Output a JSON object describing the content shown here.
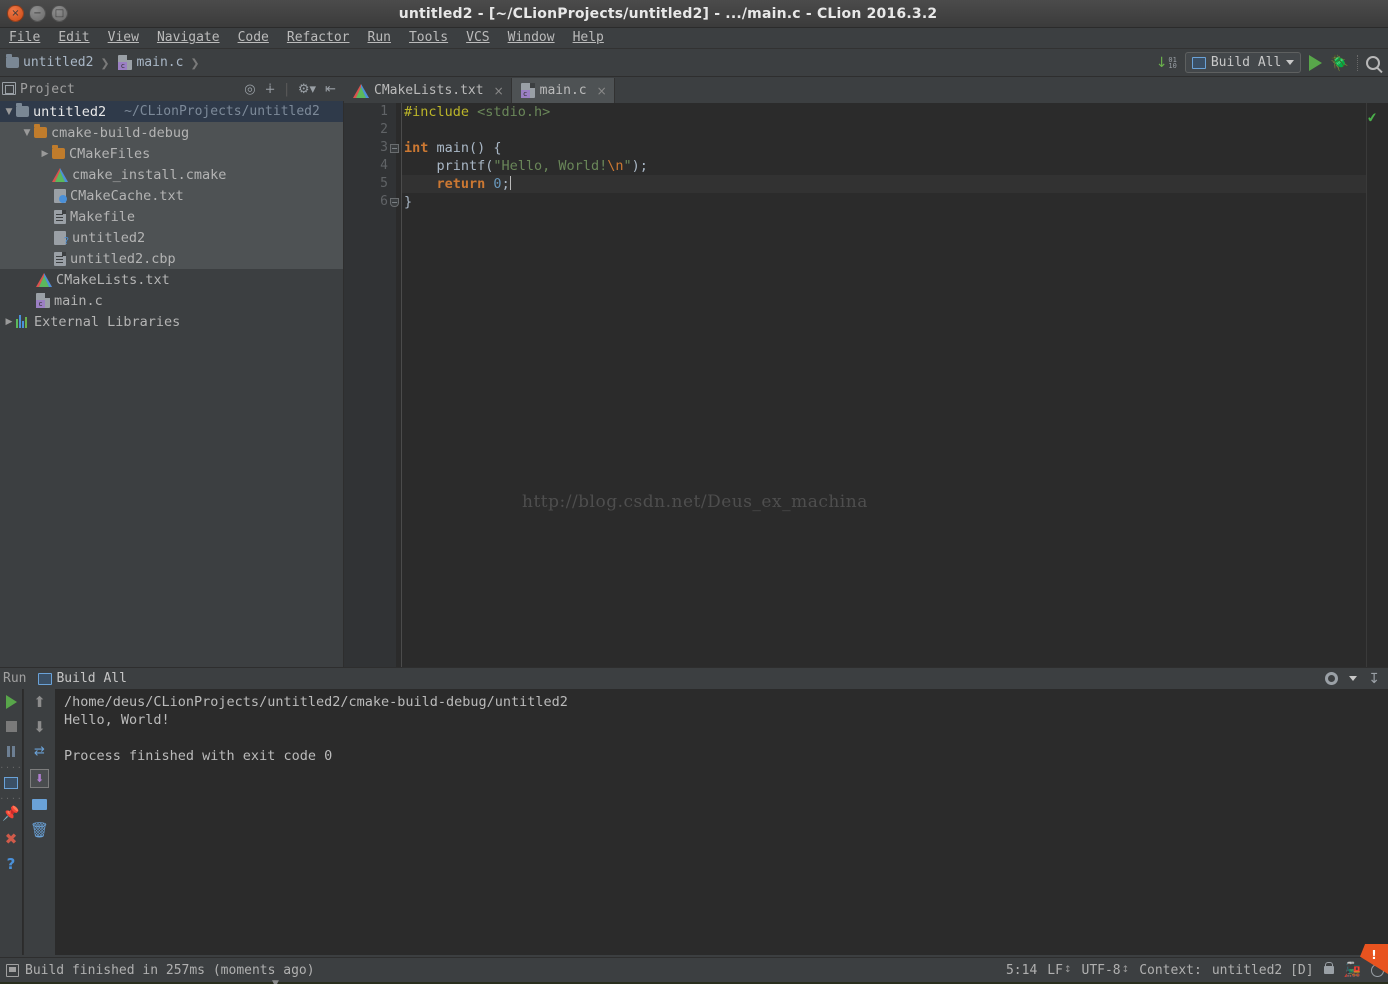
{
  "window": {
    "title": "untitled2 - [~/CLionProjects/untitled2] - .../main.c - CLion 2016.3.2",
    "close_glyph": "×",
    "min_glyph": "−",
    "max_glyph": "□"
  },
  "menubar": {
    "items": [
      {
        "label": "File",
        "mnemonic": "F"
      },
      {
        "label": "Edit",
        "mnemonic": "E"
      },
      {
        "label": "View",
        "mnemonic": "V"
      },
      {
        "label": "Navigate",
        "mnemonic": "N"
      },
      {
        "label": "Code",
        "mnemonic": "C"
      },
      {
        "label": "Refactor",
        "mnemonic": "R"
      },
      {
        "label": "Run",
        "mnemonic": "u"
      },
      {
        "label": "Tools",
        "mnemonic": "T"
      },
      {
        "label": "VCS",
        "mnemonic": "S"
      },
      {
        "label": "Window",
        "mnemonic": "W"
      },
      {
        "label": "Help",
        "mnemonic": "H"
      }
    ]
  },
  "navbar": {
    "crumbs": [
      "untitled2",
      "main.c"
    ],
    "separator": "❯",
    "binary_digits_top": "01",
    "binary_digits_bottom": "10",
    "run_config": "Build All",
    "run_button": "Run",
    "debug_button": "Debug",
    "search_button": "Search Everywhere"
  },
  "project_panel": {
    "title": "Project",
    "actions": [
      "target-icon",
      "collapse-all-icon",
      "settings-gear-icon",
      "hide-icon"
    ],
    "tree": [
      {
        "label": "untitled2",
        "sub": "~/CLionProjects/untitled2",
        "icon": "folder-blue",
        "arrow": "▼",
        "indent": 0,
        "state": "selected"
      },
      {
        "label": "cmake-build-debug",
        "icon": "folder-orange",
        "arrow": "▼",
        "indent": 1,
        "state": "highlight"
      },
      {
        "label": "CMakeFiles",
        "icon": "folder-orange",
        "arrow": "▶",
        "indent": 2,
        "state": "highlight"
      },
      {
        "label": "cmake_install.cmake",
        "icon": "cmake",
        "arrow": "",
        "indent": 2,
        "state": "highlight"
      },
      {
        "label": "CMakeCache.txt",
        "icon": "cache-file",
        "arrow": "",
        "indent": 2,
        "state": "highlight"
      },
      {
        "label": "Makefile",
        "icon": "text-file",
        "arrow": "",
        "indent": 2,
        "state": "highlight"
      },
      {
        "label": "untitled2",
        "icon": "binary-file",
        "arrow": "",
        "indent": 2,
        "state": "highlight"
      },
      {
        "label": "untitled2.cbp",
        "icon": "text-file",
        "arrow": "",
        "indent": 2,
        "state": "highlight"
      },
      {
        "label": "CMakeLists.txt",
        "icon": "cmake",
        "arrow": "",
        "indent": 1,
        "state": "normal"
      },
      {
        "label": "main.c",
        "icon": "c-file",
        "arrow": "",
        "indent": 1,
        "state": "normal"
      },
      {
        "label": "External Libraries",
        "icon": "library",
        "arrow": "▶",
        "indent": 0,
        "state": "normal"
      }
    ]
  },
  "editor": {
    "tabs": [
      {
        "label": "CMakeLists.txt",
        "icon": "cmake-icon",
        "active": false,
        "close": "×"
      },
      {
        "label": "main.c",
        "icon": "c-file-icon",
        "active": true,
        "close": "×"
      }
    ],
    "line_numbers": [
      "1",
      "2",
      "3",
      "4",
      "5",
      "6"
    ],
    "lines": [
      {
        "n": 1,
        "tokens": [
          {
            "t": "#include ",
            "c": "k-pre"
          },
          {
            "t": "<stdio.h>",
            "c": "k-hdr"
          }
        ]
      },
      {
        "n": 2,
        "tokens": []
      },
      {
        "n": 3,
        "tokens": [
          {
            "t": "int",
            "c": "k-kw"
          },
          {
            "t": " main() {",
            "c": "k-fn"
          }
        ]
      },
      {
        "n": 4,
        "tokens": [
          {
            "t": "    printf(",
            "c": "k-fn"
          },
          {
            "t": "\"Hello, World!",
            "c": "k-str"
          },
          {
            "t": "\\n",
            "c": "k-esc"
          },
          {
            "t": "\"",
            "c": "k-str"
          },
          {
            "t": ");",
            "c": "k-pun"
          }
        ]
      },
      {
        "n": 5,
        "tokens": [
          {
            "t": "    return",
            "c": "k-kw"
          },
          {
            "t": " ",
            "c": "k-fn"
          },
          {
            "t": "0",
            "c": "k-num"
          },
          {
            "t": ";",
            "c": "k-pun"
          }
        ],
        "current": true
      },
      {
        "n": 6,
        "tokens": [
          {
            "t": "}",
            "c": "k-fn"
          }
        ]
      }
    ],
    "watermark": "http://blog.csdn.net/Deus_ex_machina",
    "inspection_status": "✔"
  },
  "run_panel": {
    "tool_window": "Run",
    "tab_label": "Build All",
    "left_buttons": [
      "rerun-icon",
      "stop-icon",
      "pause-icon",
      "console-icon",
      "pin-icon",
      "close-icon",
      "help-icon"
    ],
    "right_buttons": [
      "scroll-up-icon",
      "scroll-down-icon",
      "soft-wrap-icon",
      "scroll-to-end-icon",
      "print-icon",
      "trash-icon"
    ],
    "header_actions": [
      "settings-gear-icon",
      "hide-icon"
    ],
    "output": [
      "/home/deus/CLionProjects/untitled2/cmake-build-debug/untitled2",
      "Hello, World!",
      "",
      "Process finished with exit code 0"
    ]
  },
  "statusbar": {
    "message": "Build finished in 257ms (moments ago)",
    "caret_position": "5:14",
    "line_separator": "LF",
    "encoding": "UTF-8",
    "context_label": "Context:",
    "context_value": "untitled2 [D]",
    "notification_badge": "!",
    "icons": [
      "memory-icon",
      "lock-icon",
      "train-icon",
      "clock-icon"
    ]
  },
  "colors": {
    "chrome": "#3c3f41",
    "editor_bg": "#2b2b2b",
    "gutter": "#313335",
    "accent_green": "#58a64a",
    "accent_orange": "#cc7832",
    "string_green": "#6a8759",
    "number_blue": "#6897bb",
    "selection_blue": "#2f3a4a",
    "notification_orange": "#e8531f"
  }
}
